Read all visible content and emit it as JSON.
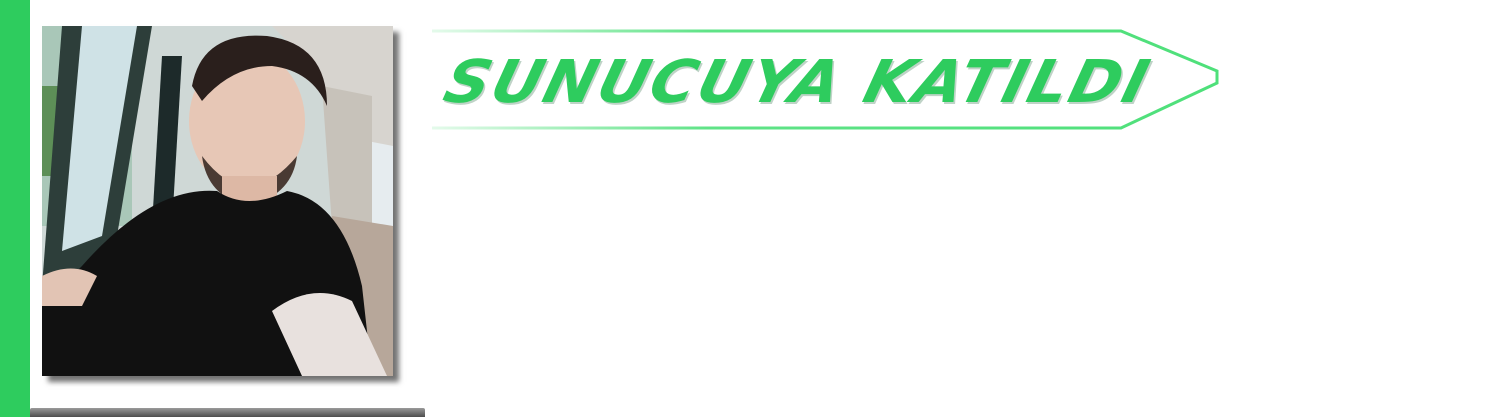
{
  "notification": {
    "title": "SUNUCUYA KATILDI"
  },
  "colors": {
    "accent": "#2ecc5e",
    "banner_text": "#2ecc5e",
    "banner_outline": "#4ee07a",
    "shadow": "#4d4d4d"
  },
  "icons": {
    "member_avatar": "avatar-photo"
  }
}
